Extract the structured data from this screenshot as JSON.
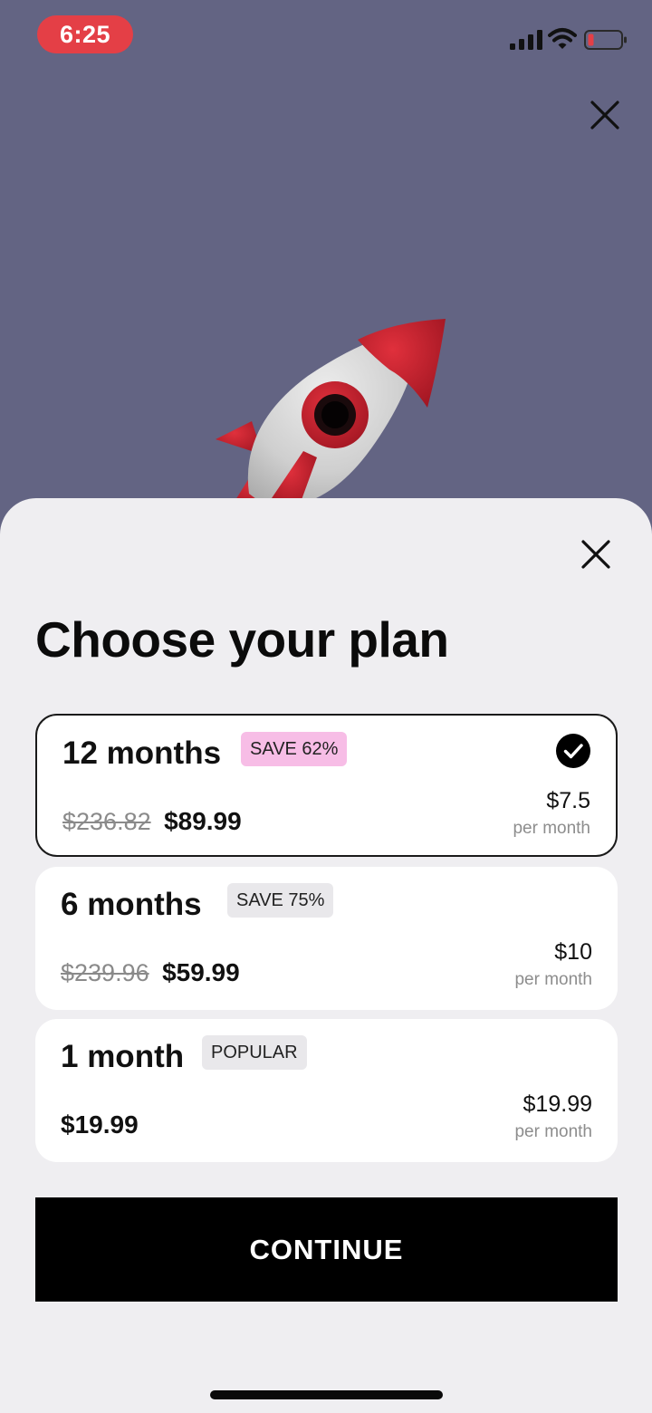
{
  "status_bar": {
    "time": "6:25",
    "icons": [
      "signal-icon",
      "wifi-icon",
      "battery-low-icon"
    ]
  },
  "colors": {
    "background": "#636483",
    "sheet": "#efeef1",
    "time_pill": "#e43f46",
    "save_badge_pink": "#f7bde6",
    "badge_gray": "#e9e8eb",
    "button": "#000000",
    "rocket_red": "#c8202c"
  },
  "icons": {
    "top_close": "close-icon",
    "sheet_close": "close-icon",
    "selected_check": "check-circle-icon"
  },
  "sheet": {
    "title": "Choose your plan"
  },
  "plans": [
    {
      "name": "12 months",
      "badge": "SAVE 62%",
      "old_price": "$236.82",
      "price": "$89.99",
      "per_month_price": "$7.5",
      "per_month_label": "per month",
      "selected": true
    },
    {
      "name": "6 months",
      "badge": "SAVE 75%",
      "old_price": "$239.96",
      "price": "$59.99",
      "per_month_price": "$10",
      "per_month_label": "per month",
      "selected": false
    },
    {
      "name": "1 month",
      "badge": "POPULAR",
      "price": "$19.99",
      "per_month_price": "$19.99",
      "per_month_label": "per month",
      "selected": false
    }
  ],
  "continue_button": {
    "label": "CONTINUE"
  }
}
